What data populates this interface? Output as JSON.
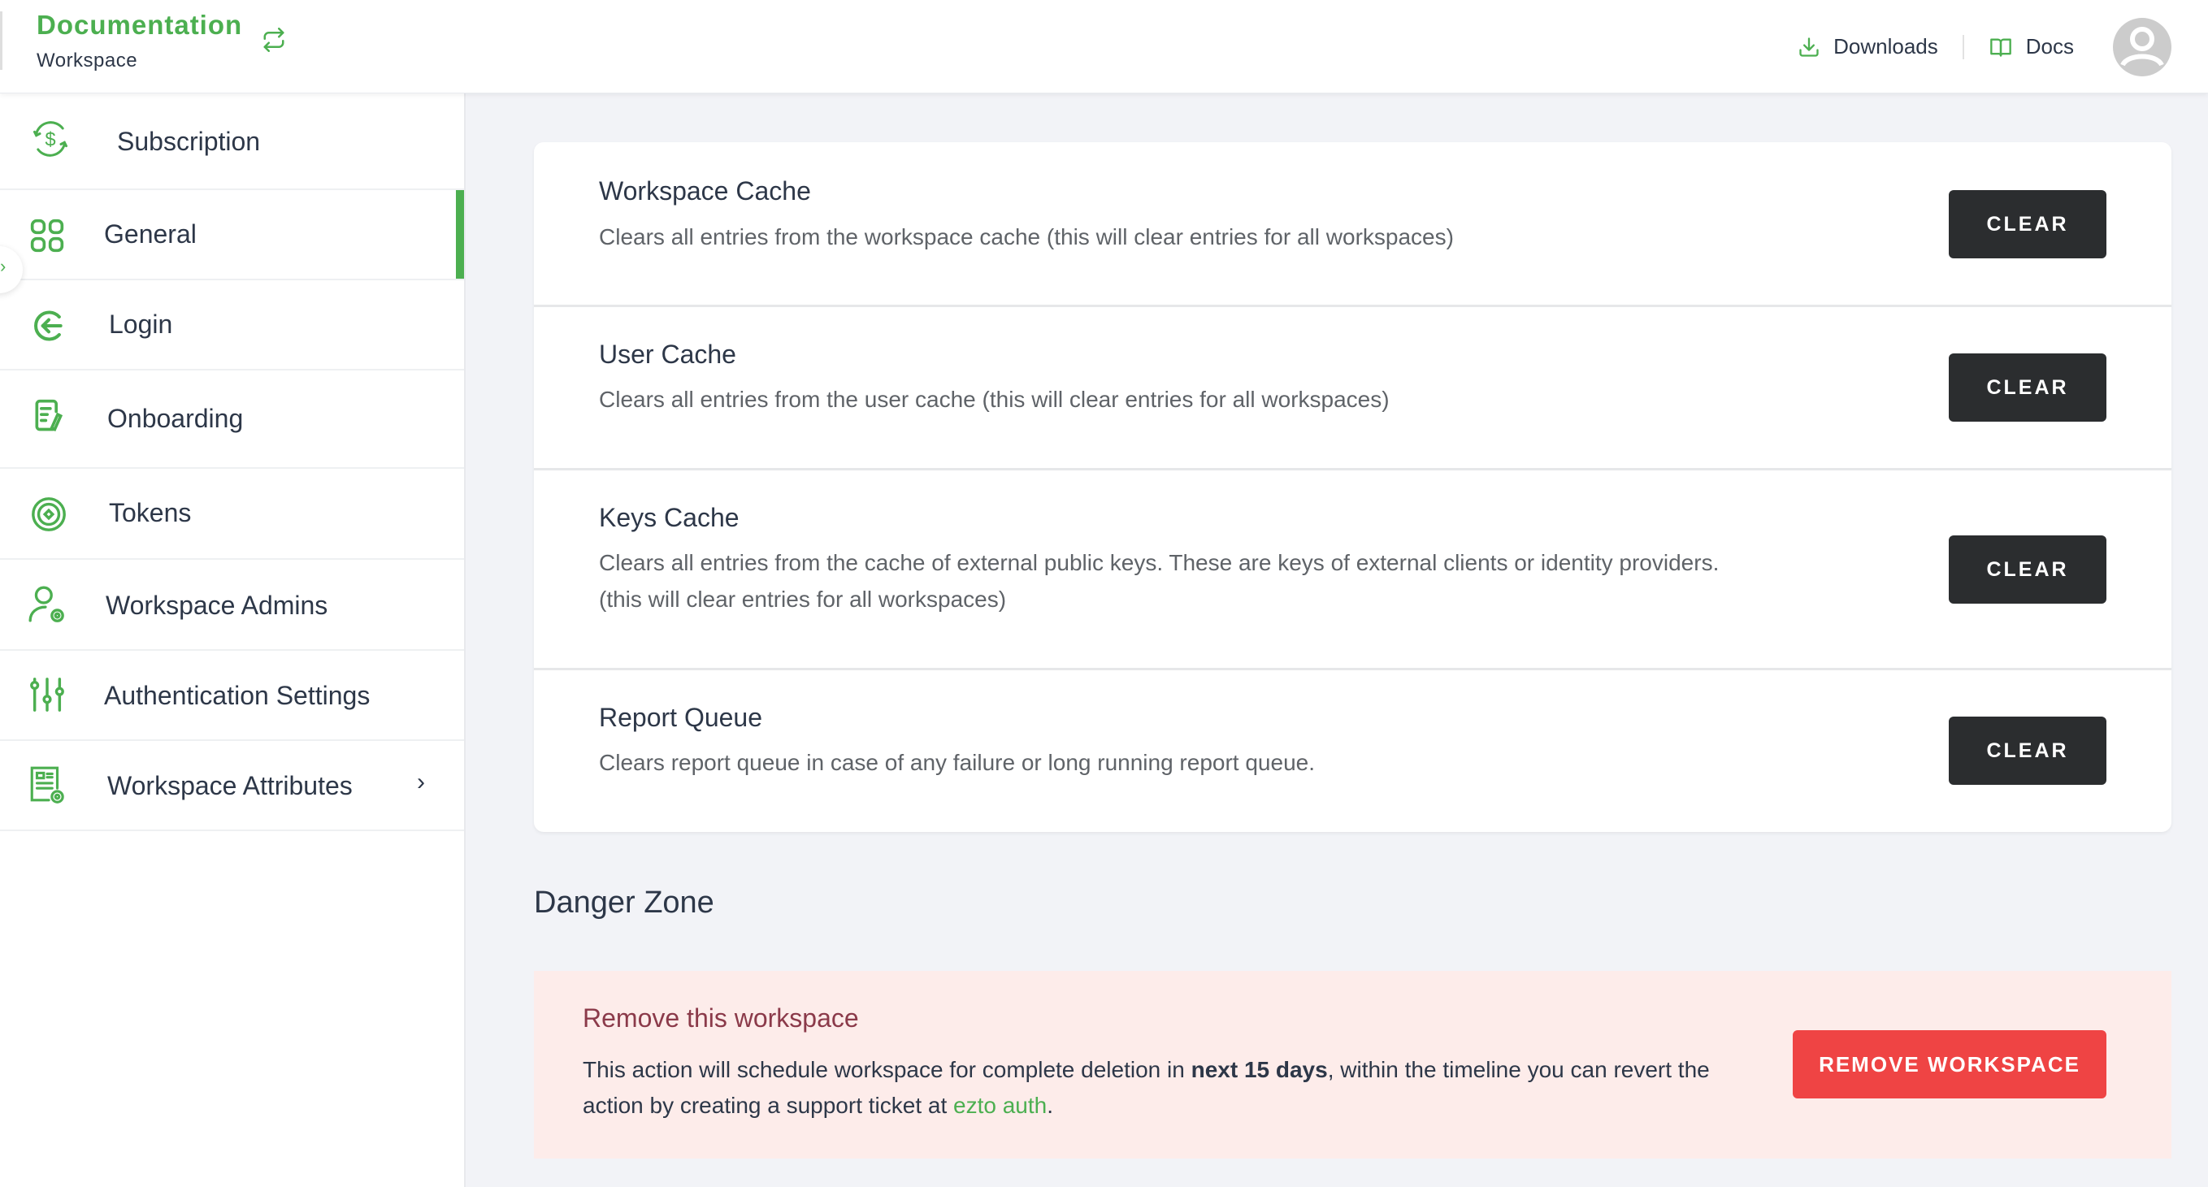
{
  "header": {
    "org_name": "Documentation",
    "org_type": "Workspace",
    "links": [
      {
        "label": "Downloads",
        "icon": "download-icon"
      },
      {
        "label": "Docs",
        "icon": "book-icon"
      }
    ]
  },
  "sidebar": {
    "items": [
      {
        "label": "Subscription",
        "icon": "subscription-dollar-icon",
        "active": false
      },
      {
        "label": "General",
        "icon": "grid-icon",
        "active": true
      },
      {
        "label": "Login",
        "icon": "login-arrow-icon",
        "active": false
      },
      {
        "label": "Onboarding",
        "icon": "document-edit-icon",
        "active": false
      },
      {
        "label": "Tokens",
        "icon": "token-target-icon",
        "active": false
      },
      {
        "label": "Workspace Admins",
        "icon": "user-gear-icon",
        "active": false
      },
      {
        "label": "Authentication Settings",
        "icon": "sliders-icon",
        "active": false
      },
      {
        "label": "Workspace Attributes",
        "icon": "form-gear-icon",
        "active": false,
        "has_submenu": true
      }
    ],
    "submenu_chevron": "›",
    "collapse_glyph": "›"
  },
  "cache_sections": [
    {
      "title": "Workspace Cache",
      "description": "Clears all entries from the workspace cache (this will clear entries for all workspaces)",
      "button": "CLEAR"
    },
    {
      "title": "User Cache",
      "description": "Clears all entries from the user cache (this will clear entries for all workspaces)",
      "button": "CLEAR"
    },
    {
      "title": "Keys Cache",
      "description": "Clears all entries from the cache of external public keys. These are keys of external clients or identity providers. (this will clear entries for all workspaces)",
      "button": "CLEAR"
    },
    {
      "title": "Report Queue",
      "description": "Clears report queue in case of any failure or long running report queue.",
      "button": "CLEAR"
    }
  ],
  "danger_zone": {
    "title": "Danger Zone",
    "heading": "Remove this workspace",
    "text_before": "This action will schedule workspace for complete deletion in ",
    "text_bold": "next 15 days",
    "text_middle": ", within the timeline you can revert the action by creating a support ticket at ",
    "link_text": "ezto auth",
    "text_after": ".",
    "button": "REMOVE WORKSPACE"
  },
  "colors": {
    "accent": "#4caf50",
    "danger": "#ef4444",
    "danger_bg": "#fdecea",
    "dark_button": "#2b2d2f"
  }
}
